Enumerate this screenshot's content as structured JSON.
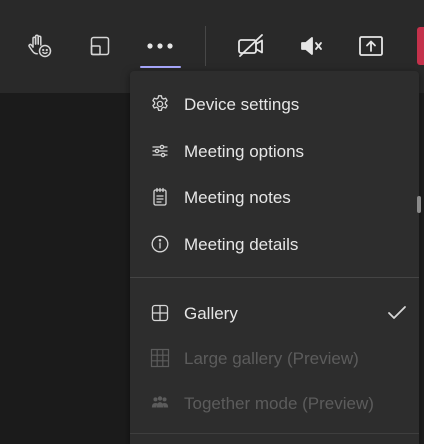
{
  "toolbar": {
    "buttons": [
      {
        "icon": "raise-hand-icon"
      },
      {
        "icon": "pop-out-icon"
      },
      {
        "icon": "more-actions-icon"
      },
      {
        "icon": "camera-off-icon"
      },
      {
        "icon": "speaker-mute-icon"
      },
      {
        "icon": "share-tray-icon"
      }
    ],
    "hangup_color": "#c4314b",
    "active_underline_color": "#a9a9ff"
  },
  "menu": {
    "items": [
      {
        "label": "Device settings",
        "icon": "gear-icon",
        "enabled": true
      },
      {
        "label": "Meeting options",
        "icon": "sliders-icon",
        "enabled": true
      },
      {
        "label": "Meeting notes",
        "icon": "notes-icon",
        "enabled": true
      },
      {
        "label": "Meeting details",
        "icon": "info-icon",
        "enabled": true
      }
    ],
    "layout_items": [
      {
        "label": "Gallery",
        "icon": "gallery-icon",
        "enabled": true,
        "checked": true
      },
      {
        "label": "Large gallery (Preview)",
        "icon": "large-gallery-icon",
        "enabled": false,
        "checked": false
      },
      {
        "label": "Together mode (Preview)",
        "icon": "together-mode-icon",
        "enabled": false,
        "checked": false
      }
    ]
  }
}
